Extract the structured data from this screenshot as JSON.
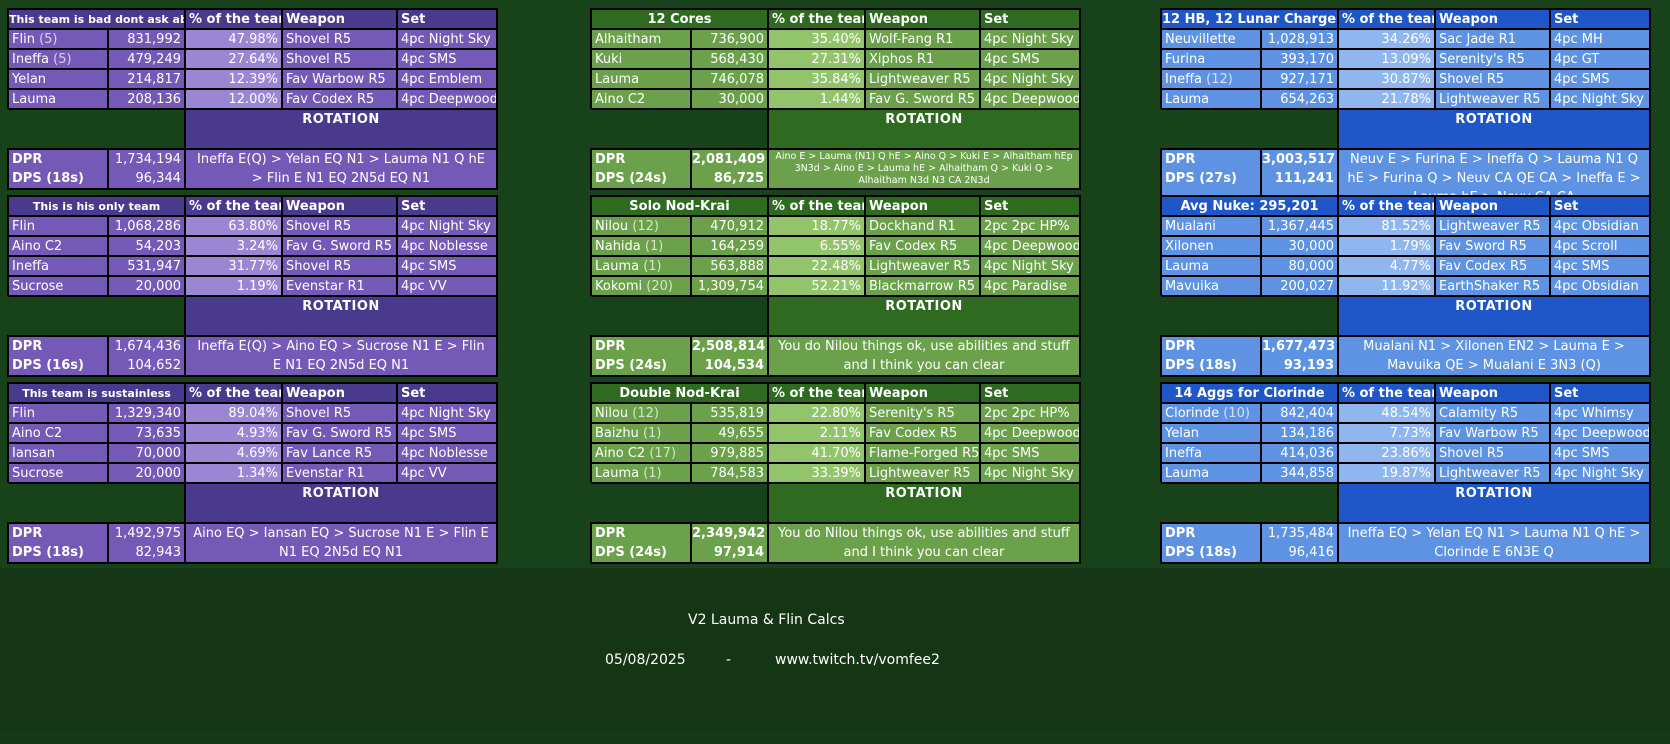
{
  "headers": {
    "pct": "% of the team",
    "weapon": "Weapon",
    "set": "Set",
    "rotation": "ROTATION"
  },
  "colors": {
    "background": "#18421a",
    "purple": "#7459b7",
    "green": "#6aa14a",
    "blue": "#5e93e3"
  },
  "footer": {
    "title": "V2 Lauma & Flin Calcs",
    "date": "05/08/2025",
    "separator": "-",
    "url": "www.twitch.tv/vomfee2"
  },
  "teams": [
    {
      "title": "This team is bad dont ask about it",
      "rows": [
        {
          "name": "Flin",
          "note": "(5)",
          "dmg": "831,992",
          "pct": "47.98%",
          "weapon": "Shovel R5",
          "set": "4pc Night Sky"
        },
        {
          "name": "Ineffa",
          "note": "(5)",
          "dmg": "479,249",
          "pct": "27.64%",
          "weapon": "Shovel R5",
          "set": "4pc SMS"
        },
        {
          "name": "Yelan",
          "note": "",
          "dmg": "214,817",
          "pct": "12.39%",
          "weapon": "Fav Warbow R5",
          "set": "4pc Emblem"
        },
        {
          "name": "Lauma",
          "note": "",
          "dmg": "208,136",
          "pct": "12.00%",
          "weapon": "Fav Codex R5",
          "set": "4pc Deepwood"
        }
      ],
      "dpr_label": "DPR",
      "dpr": "1,734,194",
      "dps_label": "DPS (18s)",
      "dps": "96,344",
      "rotation": "Ineffa E(Q) > Yelan EQ N1 > Lauma N1 Q hE > Flin E N1 EQ 2N5d EQ N1"
    },
    {
      "title": "12 Cores",
      "rows": [
        {
          "name": "Alhaitham",
          "note": "",
          "dmg": "736,900",
          "pct": "35.40%",
          "weapon": "Wolf-Fang R1",
          "set": "4pc Night Sky"
        },
        {
          "name": "Kuki",
          "note": "",
          "dmg": "568,430",
          "pct": "27.31%",
          "weapon": "Xiphos R1",
          "set": "4pc SMS"
        },
        {
          "name": "Lauma",
          "note": "",
          "dmg": "746,078",
          "pct": "35.84%",
          "weapon": "Lightweaver R5",
          "set": "4pc Night Sky"
        },
        {
          "name": "Aino C2",
          "note": "",
          "dmg": "30,000",
          "pct": "1.44%",
          "weapon": "Fav G. Sword R5",
          "set": "4pc Deepwood"
        }
      ],
      "dpr_label": "DPR",
      "dpr": "2,081,409",
      "dps_label": "DPS (24s)",
      "dps": "86,725",
      "rotation": "Aino E > Lauma (N1) Q hE > Aino Q > Kuki E > Alhaitham hEp 3N3d > Aino E > Lauma hE > Alhaitham Q > Kuki Q > Alhaitham N3d N3 CA 2N3d"
    },
    {
      "title": "12 HB, 12 Lunar Charges",
      "rows": [
        {
          "name": "Neuvillette",
          "note": "",
          "dmg": "1,028,913",
          "pct": "34.26%",
          "weapon": "Sac Jade R1",
          "set": "4pc MH"
        },
        {
          "name": "Furina",
          "note": "",
          "dmg": "393,170",
          "pct": "13.09%",
          "weapon": "Serenity's R5",
          "set": "4pc GT"
        },
        {
          "name": "Ineffa",
          "note": "(12)",
          "dmg": "927,171",
          "pct": "30.87%",
          "weapon": "Shovel R5",
          "set": "4pc SMS"
        },
        {
          "name": "Lauma",
          "note": "",
          "dmg": "654,263",
          "pct": "21.78%",
          "weapon": "Lightweaver R5",
          "set": "4pc Night Sky"
        }
      ],
      "dpr_label": "DPR",
      "dpr": "3,003,517",
      "dps_label": "DPS (27s)",
      "dps": "111,241",
      "rotation": "Neuv E > Furina E > Ineffa Q > Lauma N1 Q hE > Furina Q > Neuv CA QE CA > Ineffa E > Lauma hE > Neuv CA CA"
    },
    {
      "title": "This is his only team",
      "rows": [
        {
          "name": "Flin",
          "note": "",
          "dmg": "1,068,286",
          "pct": "63.80%",
          "weapon": "Shovel R5",
          "set": "4pc Night Sky"
        },
        {
          "name": "Aino C2",
          "note": "",
          "dmg": "54,203",
          "pct": "3.24%",
          "weapon": "Fav G. Sword R5",
          "set": "4pc Noblesse"
        },
        {
          "name": "Ineffa",
          "note": "",
          "dmg": "531,947",
          "pct": "31.77%",
          "weapon": "Shovel R5",
          "set": "4pc SMS"
        },
        {
          "name": "Sucrose",
          "note": "",
          "dmg": "20,000",
          "pct": "1.19%",
          "weapon": "Evenstar R1",
          "set": "4pc VV"
        }
      ],
      "dpr_label": "DPR",
      "dpr": "1,674,436",
      "dps_label": "DPS (16s)",
      "dps": "104,652",
      "rotation": "Ineffa E(Q) > Aino EQ > Sucrose N1 E > Flin E N1 EQ 2N5d EQ N1"
    },
    {
      "title": "Solo Nod-Krai",
      "rows": [
        {
          "name": "Nilou",
          "note": "(12)",
          "dmg": "470,912",
          "pct": "18.77%",
          "weapon": "Dockhand R1",
          "set": "2pc 2pc HP%"
        },
        {
          "name": "Nahida",
          "note": "(1)",
          "dmg": "164,259",
          "pct": "6.55%",
          "weapon": "Fav Codex R5",
          "set": "4pc Deepwood"
        },
        {
          "name": "Lauma",
          "note": "(1)",
          "dmg": "563,888",
          "pct": "22.48%",
          "weapon": "Lightweaver R5",
          "set": "4pc Night Sky"
        },
        {
          "name": "Kokomi",
          "note": "(20)",
          "dmg": "1,309,754",
          "pct": "52.21%",
          "weapon": "Blackmarrow R5",
          "set": "4pc Paradise"
        }
      ],
      "dpr_label": "DPR",
      "dpr": "2,508,814",
      "dps_label": "DPS (24s)",
      "dps": "104,534",
      "rotation": "You do Nilou things ok, use abilities and stuff and I think you can clear"
    },
    {
      "title": "Avg Nuke: 295,201",
      "rows": [
        {
          "name": "Mualani",
          "note": "",
          "dmg": "1,367,445",
          "pct": "81.52%",
          "weapon": "Lightweaver R5",
          "set": "4pc Obsidian"
        },
        {
          "name": "Xilonen",
          "note": "",
          "dmg": "30,000",
          "pct": "1.79%",
          "weapon": "Fav Sword R5",
          "set": "4pc Scroll"
        },
        {
          "name": "Lauma",
          "note": "",
          "dmg": "80,000",
          "pct": "4.77%",
          "weapon": "Fav Codex R5",
          "set": "4pc SMS"
        },
        {
          "name": "Mavuika",
          "note": "",
          "dmg": "200,027",
          "pct": "11.92%",
          "weapon": "EarthShaker R5",
          "set": "4pc Obsidian"
        }
      ],
      "dpr_label": "DPR",
      "dpr": "1,677,473",
      "dps_label": "DPS (18s)",
      "dps": "93,193",
      "rotation": "Mualani N1 > Xilonen EN2 > Lauma E > Mavuika QE > Mualani E 3N3 (Q)"
    },
    {
      "title": "This team is sustainless",
      "rows": [
        {
          "name": "Flin",
          "note": "",
          "dmg": "1,329,340",
          "pct": "89.04%",
          "weapon": "Shovel R5",
          "set": "4pc Night Sky"
        },
        {
          "name": "Aino C2",
          "note": "",
          "dmg": "73,635",
          "pct": "4.93%",
          "weapon": "Fav G. Sword R5",
          "set": "4pc SMS"
        },
        {
          "name": "Iansan",
          "note": "",
          "dmg": "70,000",
          "pct": "4.69%",
          "weapon": "Fav Lance R5",
          "set": "4pc Noblesse"
        },
        {
          "name": "Sucrose",
          "note": "",
          "dmg": "20,000",
          "pct": "1.34%",
          "weapon": "Evenstar R1",
          "set": "4pc VV"
        }
      ],
      "dpr_label": "DPR",
      "dpr": "1,492,975",
      "dps_label": "DPS (18s)",
      "dps": "82,943",
      "rotation": "Aino EQ > Iansan EQ > Sucrose N1 E > Flin E N1 EQ 2N5d EQ N1"
    },
    {
      "title": "Double Nod-Krai",
      "rows": [
        {
          "name": "Nilou",
          "note": "(12)",
          "dmg": "535,819",
          "pct": "22.80%",
          "weapon": "Serenity's R5",
          "set": "2pc 2pc HP%"
        },
        {
          "name": "Baizhu",
          "note": "(1)",
          "dmg": "49,655",
          "pct": "2.11%",
          "weapon": "Fav Codex R5",
          "set": "4pc Deepwood"
        },
        {
          "name": "Aino C2",
          "note": "(17)",
          "dmg": "979,885",
          "pct": "41.70%",
          "weapon": "Flame-Forged R5",
          "set": "4pc SMS"
        },
        {
          "name": "Lauma",
          "note": "(1)",
          "dmg": "784,583",
          "pct": "33.39%",
          "weapon": "Lightweaver R5",
          "set": "4pc Night Sky"
        }
      ],
      "dpr_label": "DPR",
      "dpr": "2,349,942",
      "dps_label": "DPS (24s)",
      "dps": "97,914",
      "rotation": "You do Nilou things ok, use abilities and stuff and I think you can clear"
    },
    {
      "title": "14 Aggs for Clorinde",
      "rows": [
        {
          "name": "Clorinde",
          "note": "(10)",
          "dmg": "842,404",
          "pct": "48.54%",
          "weapon": "Calamity R5",
          "set": "4pc Whimsy"
        },
        {
          "name": "Yelan",
          "note": "",
          "dmg": "134,186",
          "pct": "7.73%",
          "weapon": "Fav Warbow R5",
          "set": "4pc Deepwood"
        },
        {
          "name": "Ineffa",
          "note": "",
          "dmg": "414,036",
          "pct": "23.86%",
          "weapon": "Shovel R5",
          "set": "4pc SMS"
        },
        {
          "name": "Lauma",
          "note": "",
          "dmg": "344,858",
          "pct": "19.87%",
          "weapon": "Lightweaver R5",
          "set": "4pc Night Sky"
        }
      ],
      "dpr_label": "DPR",
      "dpr": "1,735,484",
      "dps_label": "DPS (18s)",
      "dps": "96,416",
      "rotation": "Ineffa EQ > Yelan EQ N1 > Lauma N1 Q hE > Clorinde E 6N3E Q"
    }
  ]
}
